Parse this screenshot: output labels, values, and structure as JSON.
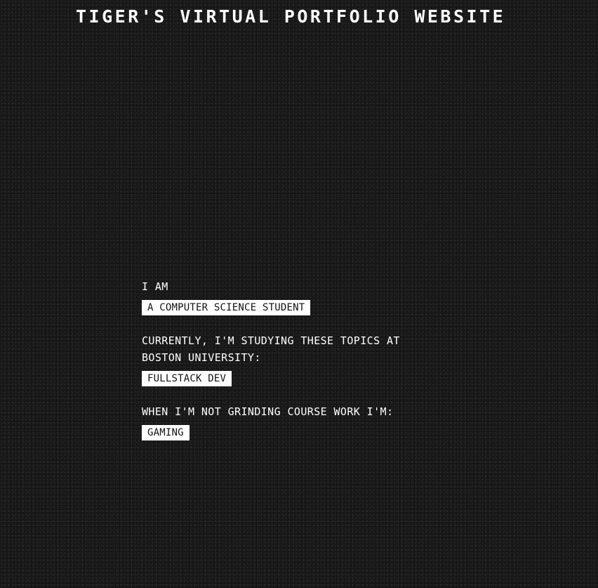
{
  "header": {
    "title": "TIGER'S VIRTUAL PORTFOLIO WEBSITE"
  },
  "about": {
    "intro_label": "I AM",
    "intro_value": "A COMPUTER SCIENCE STUDENT",
    "studying_label": "CURRENTLY, I'M STUDYING THESE TOPICS AT BOSTON UNIVERSITY:",
    "studying_value": "FULLSTACK DEV",
    "hobby_label": "WHEN I'M NOT GRINDING COURSE WORK I'M:",
    "hobby_value": "GAMING"
  },
  "colors": {
    "background": "#1c1c1c",
    "text": "#ffffff",
    "tag_background": "#ffffff",
    "tag_text": "#111111"
  }
}
